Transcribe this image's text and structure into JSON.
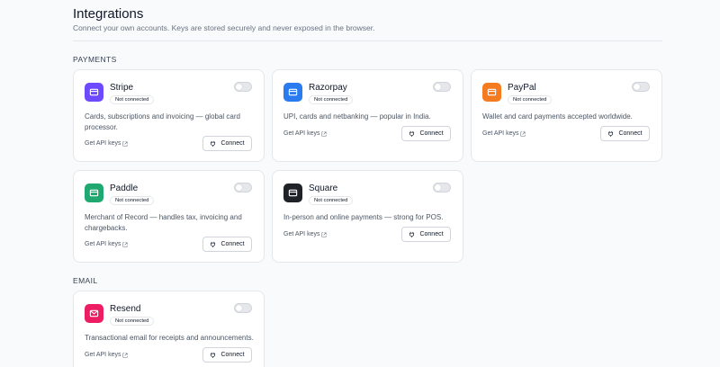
{
  "header": {
    "title": "Integrations",
    "subtitle": "Connect your own accounts. Keys are stored securely and never exposed in the browser."
  },
  "sections": [
    {
      "label": "PAYMENTS",
      "cards": [
        {
          "name": "Stripe",
          "status": "Not connected",
          "description": "Cards, subscriptions and invoicing — global card processor.",
          "api_link": "Get API keys",
          "connect_label": "Connect",
          "logo_color": "#6d4aff",
          "icon": "card-icon"
        },
        {
          "name": "Razorpay",
          "status": "Not connected",
          "description": "UPI, cards and netbanking — popular in India.",
          "api_link": "Get API keys",
          "connect_label": "Connect",
          "logo_color": "#2b7bf0",
          "icon": "card-icon"
        },
        {
          "name": "PayPal",
          "status": "Not connected",
          "description": "Wallet and card payments accepted worldwide.",
          "api_link": "Get API keys",
          "connect_label": "Connect",
          "logo_color": "#f47b20",
          "icon": "card-icon"
        },
        {
          "name": "Paddle",
          "status": "Not connected",
          "description": "Merchant of Record — handles tax, invoicing and chargebacks.",
          "api_link": "Get API keys",
          "connect_label": "Connect",
          "logo_color": "#1fa971",
          "icon": "card-icon"
        },
        {
          "name": "Square",
          "status": "Not connected",
          "description": "In-person and online payments — strong for POS.",
          "api_link": "Get API keys",
          "connect_label": "Connect",
          "logo_color": "#1f2328",
          "icon": "card-icon"
        }
      ]
    },
    {
      "label": "EMAIL",
      "cards": [
        {
          "name": "Resend",
          "status": "Not connected",
          "description": "Transactional email for receipts and announcements.",
          "api_link": "Get API keys",
          "connect_label": "Connect",
          "logo_color": "#ec1d63",
          "icon": "mail-icon"
        }
      ]
    }
  ]
}
